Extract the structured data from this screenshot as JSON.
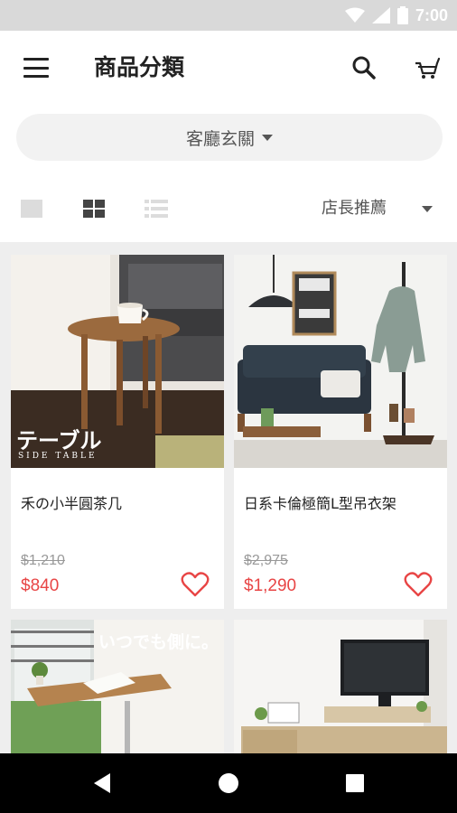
{
  "status_bar": {
    "time": "7:00",
    "icons": [
      "wifi-icon",
      "signal-icon",
      "battery-icon"
    ]
  },
  "app_bar": {
    "title": "商品分類",
    "icons": [
      "menu-icon",
      "search-icon",
      "cart-icon"
    ]
  },
  "category_filter": {
    "selected": "客廳玄關"
  },
  "toolbar": {
    "view_modes": [
      "single-view",
      "grid-view",
      "list-view"
    ],
    "active_view": "grid-view",
    "sort_label": "店長推薦"
  },
  "products": [
    {
      "name": "禾の小半圓茶几",
      "original_price": "$1,210",
      "price": "$840",
      "image_text": "テーブル",
      "image_subtext": "SIDE TABLE"
    },
    {
      "name": "日系卡倫極簡L型吊衣架",
      "original_price": "$2,975",
      "price": "$1,290",
      "image_text": "",
      "image_subtext": ""
    },
    {
      "name": "",
      "original_price": "",
      "price": "",
      "image_text": "いつでも側に。",
      "image_subtext": ""
    },
    {
      "name": "",
      "original_price": "",
      "price": "",
      "image_text": "",
      "image_subtext": ""
    }
  ],
  "colors": {
    "accent": "#e84545",
    "status_bar": "#d9d9d9",
    "grid_bg": "#eeeeee",
    "nav_bar": "#000000"
  }
}
